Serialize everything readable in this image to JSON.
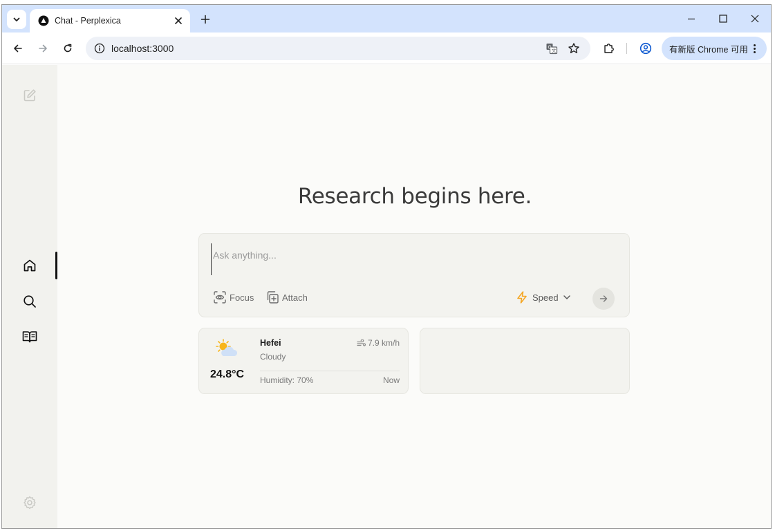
{
  "browser": {
    "tab_title": "Chat - Perplexica",
    "url": "localhost:3000",
    "chrome_pill": "有新版 Chrome 可用"
  },
  "page": {
    "headline": "Research begins here.",
    "ask": {
      "placeholder": "Ask anything...",
      "focus_label": "Focus",
      "attach_label": "Attach",
      "mode_label": "Speed"
    },
    "weather": {
      "city": "Hefei",
      "condition": "Cloudy",
      "temperature": "24.8°C",
      "wind": "7.9 km/h",
      "humidity": "Humidity: 70%",
      "time": "Now"
    }
  },
  "colors": {
    "accent_speed": "#f5a623",
    "sidebar_bg": "#f2f2ee",
    "page_bg": "#fbfbf9"
  },
  "icons": {
    "sidebar": [
      "new-chat-icon",
      "home-icon",
      "search-icon",
      "library-icon",
      "settings-icon"
    ],
    "toolbar": [
      "back-icon",
      "forward-icon",
      "reload-icon",
      "translate-icon",
      "bookmark-star-icon",
      "extensions-icon",
      "profile-icon"
    ]
  }
}
